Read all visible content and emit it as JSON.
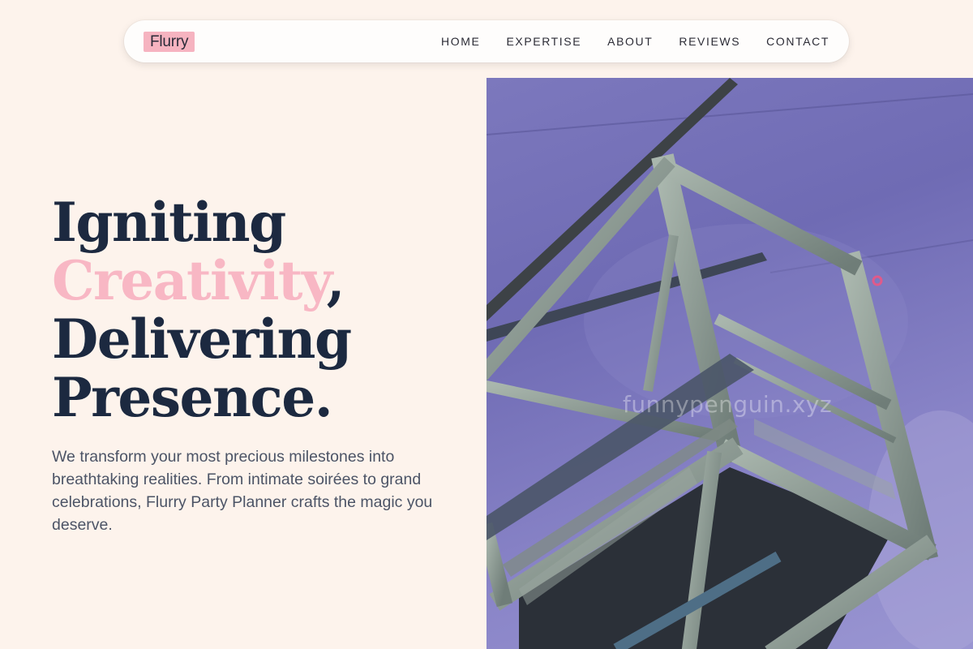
{
  "nav": {
    "logo": "Flurry",
    "items": [
      "HOME",
      "EXPERTISE",
      "ABOUT",
      "REVIEWS",
      "CONTACT"
    ]
  },
  "hero": {
    "line1": "Igniting",
    "line2_highlight": "Creativity",
    "line2_rest": ",",
    "line3": "Delivering",
    "line4": "Presence.",
    "description": "We transform your most precious milestones into breathtaking realities. From intimate soirées to grand celebrations, Flurry Party Planner crafts the magic you deserve.",
    "image_icon": "stage-truss-rig-photo",
    "watermark": "funnypenguin.xyz"
  },
  "colors": {
    "background": "#fdf3ec",
    "heading": "#1c2940",
    "accent_pink": "#f8b7c4",
    "body_text": "#4c5466"
  }
}
